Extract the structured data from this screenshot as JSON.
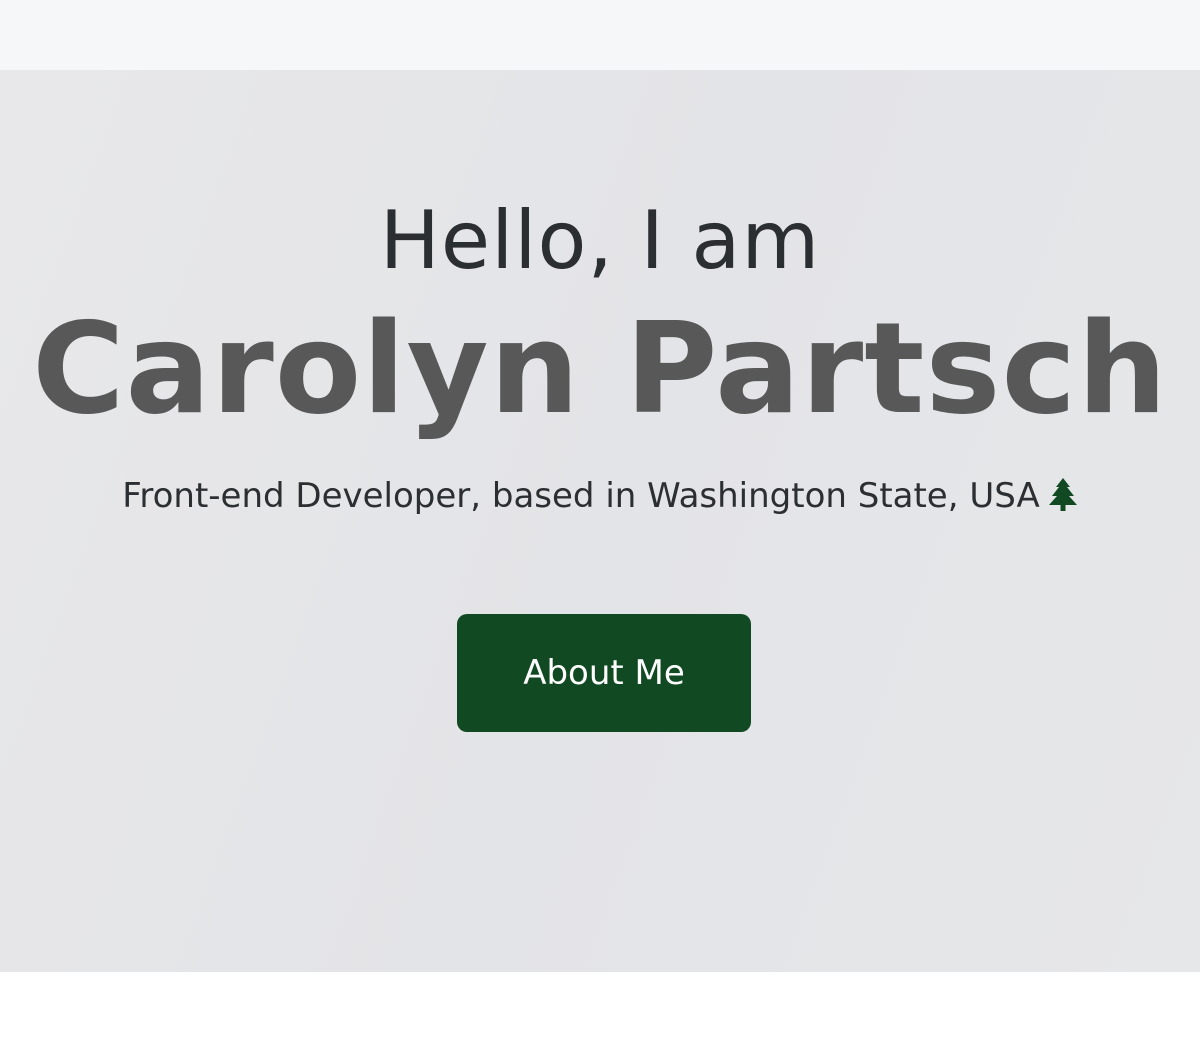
{
  "hero": {
    "greeting": "Hello, I am",
    "name": "Carolyn Partsch",
    "tagline": "Front-end Developer, based in Washington State, USA",
    "tagline_icon": "evergreen-tree-icon",
    "cta_label": "About Me"
  },
  "colors": {
    "accent": "#114a22",
    "name_text": "#585858",
    "body_text": "#2c2f31",
    "hero_bg": "#e5e6e8",
    "topbar_bg": "#f6f7f9"
  }
}
